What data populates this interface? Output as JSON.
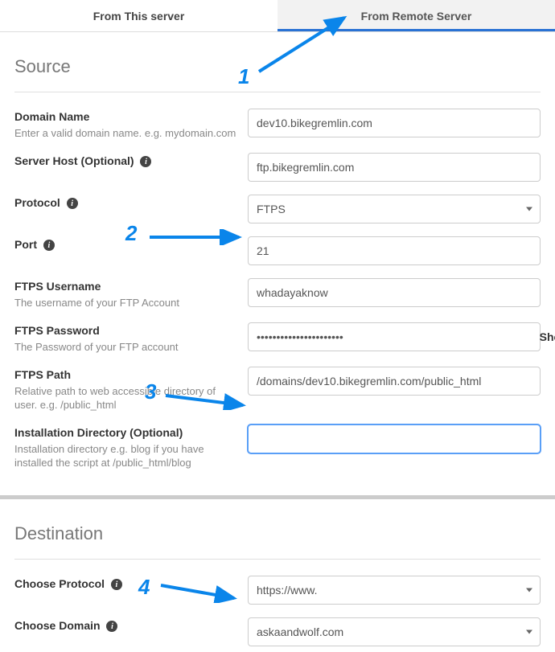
{
  "tabs": {
    "local": "From This server",
    "remote": "From Remote Server"
  },
  "source": {
    "title": "Source",
    "domain": {
      "label": "Domain Name",
      "hint": "Enter a valid domain name. e.g. mydomain.com",
      "value": "dev10.bikegremlin.com"
    },
    "server_host": {
      "label": "Server Host (Optional)",
      "value": "ftp.bikegremlin.com"
    },
    "protocol": {
      "label": "Protocol",
      "value": "FTPS"
    },
    "port": {
      "label": "Port",
      "value": "21"
    },
    "username": {
      "label": "FTPS Username",
      "hint": "The username of your FTP Account",
      "value": "whadayaknow"
    },
    "password": {
      "label": "FTPS Password",
      "hint": "The Password of your FTP account",
      "value": "••••••••••••••••••••••",
      "show": "Show"
    },
    "path": {
      "label": "FTPS Path",
      "hint": "Relative path to web accessible directory of user. e.g. /public_html",
      "value": "/domains/dev10.bikegremlin.com/public_html"
    },
    "installdir": {
      "label": "Installation Directory (Optional)",
      "hint": "Installation directory e.g. blog if you have installed the script at /public_html/blog",
      "value": ""
    }
  },
  "destination": {
    "title": "Destination",
    "protocol": {
      "label": "Choose Protocol",
      "value": "https://www."
    },
    "domain": {
      "label": "Choose Domain",
      "value": "askaandwolf.com"
    }
  },
  "annotations": {
    "n1": "1",
    "n2": "2",
    "n3": "3",
    "n4": "4"
  }
}
